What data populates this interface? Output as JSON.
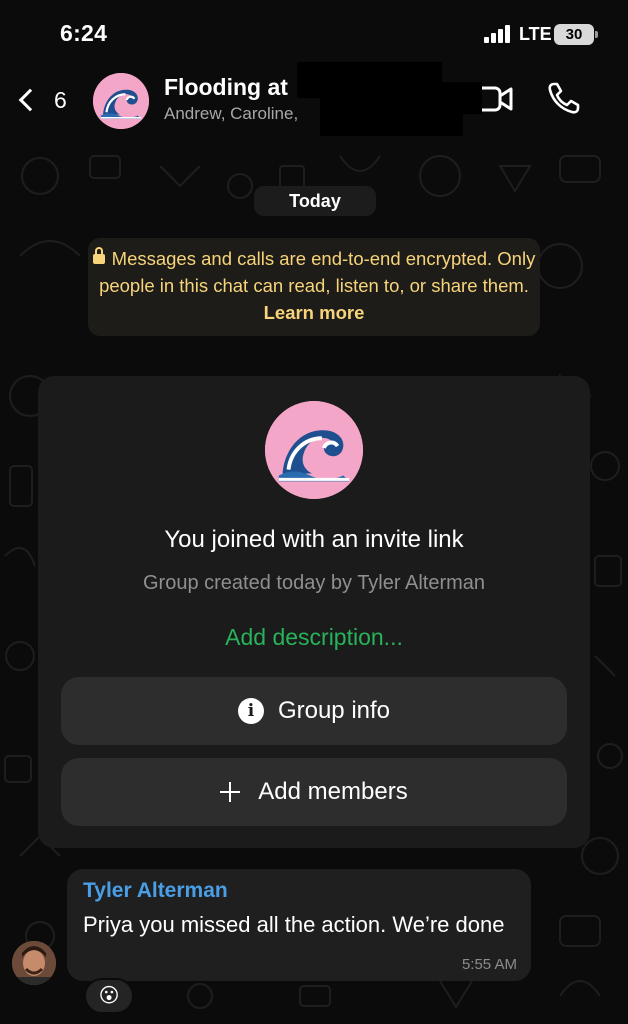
{
  "status_bar": {
    "time": "6:24",
    "network": "LTE",
    "battery": "30"
  },
  "header": {
    "back_count": "6",
    "title": "Flooding at",
    "subtitle": "Andrew, Caroline,"
  },
  "chat": {
    "date_label": "Today",
    "encryption_notice": {
      "text": "Messages and calls are end-to-end encrypted. Only people in this chat can read, listen to, or share them.",
      "link": "Learn more"
    },
    "group_card": {
      "title": "You joined with an invite link",
      "subtitle": "Group created today by Tyler Alterman",
      "description_link": "Add description...",
      "group_info_label": "Group info",
      "add_members_label": "Add members"
    },
    "messages": [
      {
        "sender": "Tyler Alterman",
        "text": "Priya you missed all the action. We’re done",
        "time": "5:55 AM",
        "reaction": "😮"
      }
    ]
  },
  "colors": {
    "background": "#0b0b0b",
    "notice_text": "#f7d47a",
    "accent_green": "#27b35a",
    "sender_blue": "#4a9ee6",
    "avatar_pink": "#f4a6c8"
  },
  "icons": [
    "back-chevron-icon",
    "wave-icon",
    "video-camera-icon",
    "phone-icon",
    "lock-icon",
    "info-icon",
    "plus-icon"
  ]
}
